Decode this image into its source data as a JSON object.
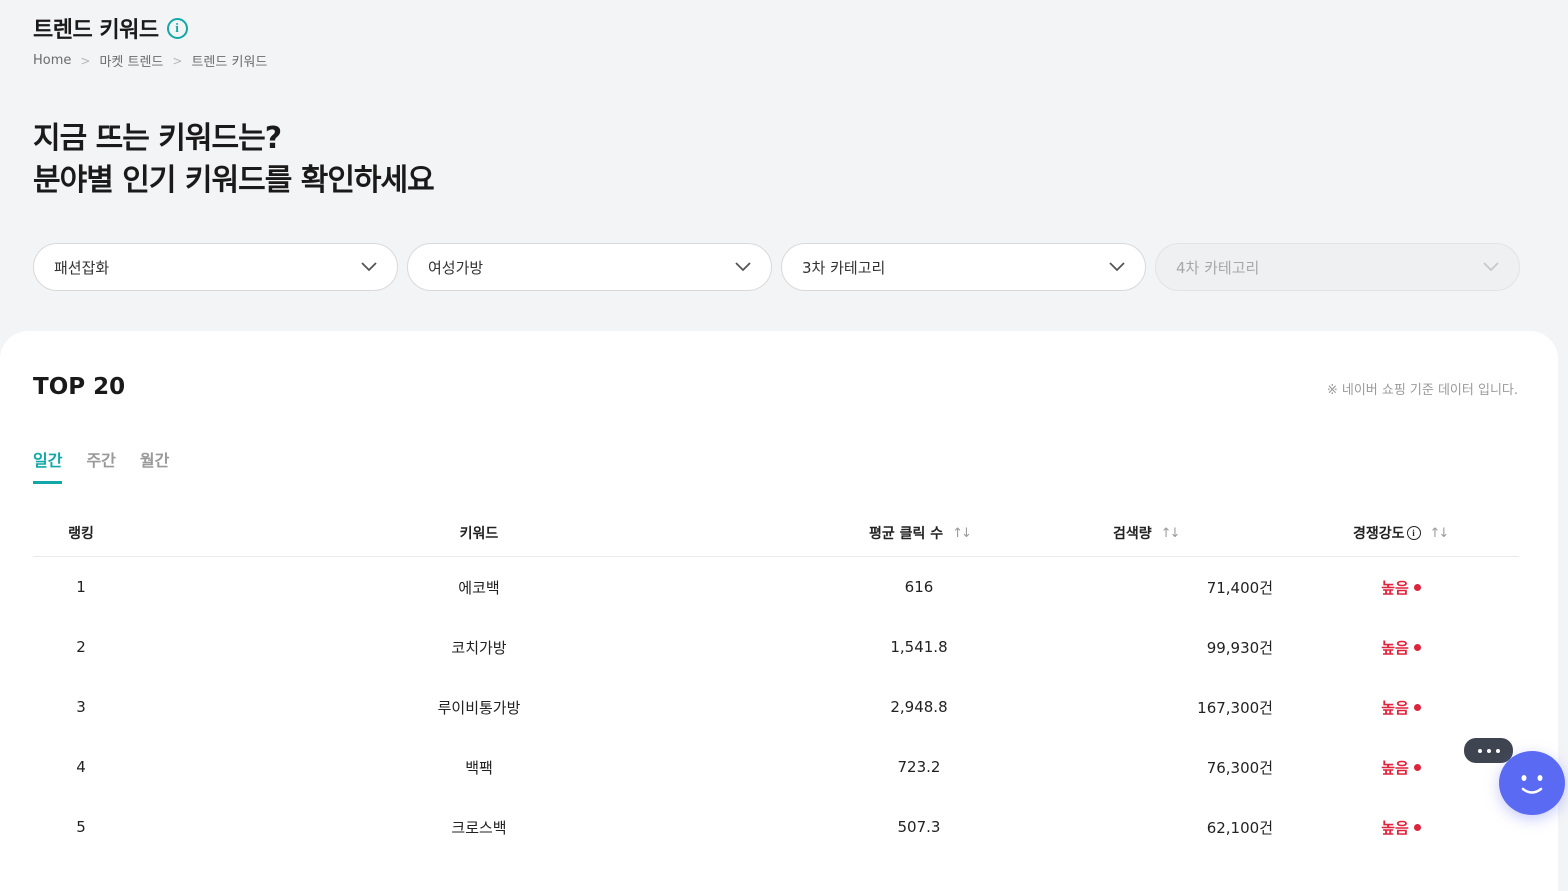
{
  "header": {
    "title": "트렌드 키워드",
    "breadcrumb": [
      "Home",
      "마켓 트렌드",
      "트렌드 키워드"
    ]
  },
  "headline": {
    "line1": "지금 뜨는 키워드는?",
    "line2": "분야별 인기 키워드를 확인하세요"
  },
  "filters": {
    "category1": "패션잡화",
    "category2": "여성가방",
    "category3": "3차 카테고리",
    "category4": "4차 카테고리"
  },
  "ranking": {
    "title": "TOP 20",
    "note": "※ 네이버 쇼핑 기준 데이터 입니다.",
    "tabs": [
      "일간",
      "주간",
      "월간"
    ],
    "active_tab": "일간",
    "columns": {
      "rank": "랭킹",
      "keyword": "키워드",
      "avg_clicks": "평균 클릭 수",
      "search_volume": "검색량",
      "competition": "경쟁강도"
    },
    "rows": [
      {
        "rank": "1",
        "keyword": "에코백",
        "avg_clicks": "616",
        "search_volume": "71,400건",
        "competition": "높음"
      },
      {
        "rank": "2",
        "keyword": "코치가방",
        "avg_clicks": "1,541.8",
        "search_volume": "99,930건",
        "competition": "높음"
      },
      {
        "rank": "3",
        "keyword": "루이비통가방",
        "avg_clicks": "2,948.8",
        "search_volume": "167,300건",
        "competition": "높음"
      },
      {
        "rank": "4",
        "keyword": "백팩",
        "avg_clicks": "723.2",
        "search_volume": "76,300건",
        "competition": "높음"
      },
      {
        "rank": "5",
        "keyword": "크로스백",
        "avg_clicks": "507.3",
        "search_volume": "62,100건",
        "competition": "높음"
      }
    ]
  },
  "colors": {
    "accent": "#12a8a8",
    "competition_high": "#e0233d",
    "chatbot": "#5b6af2"
  }
}
